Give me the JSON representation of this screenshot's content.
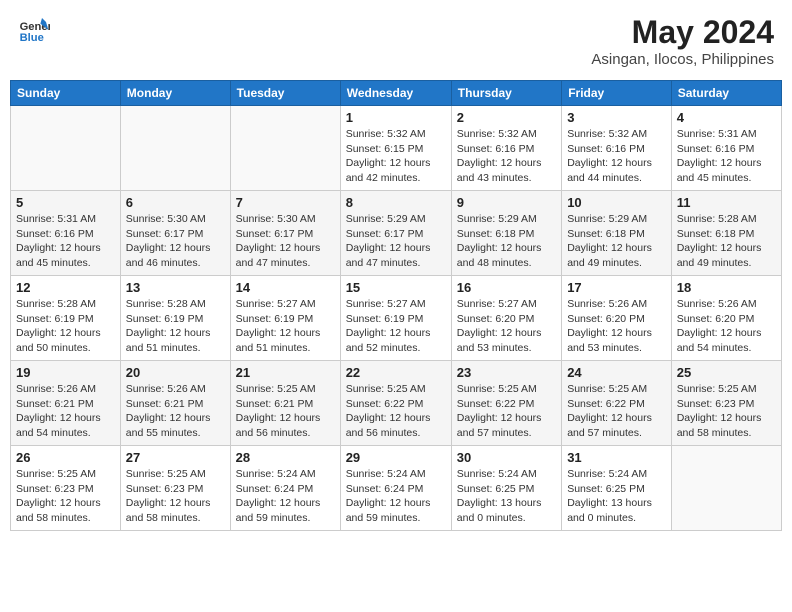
{
  "header": {
    "logo_line1": "General",
    "logo_line2": "Blue",
    "month_year": "May 2024",
    "location": "Asingan, Ilocos, Philippines"
  },
  "weekdays": [
    "Sunday",
    "Monday",
    "Tuesday",
    "Wednesday",
    "Thursday",
    "Friday",
    "Saturday"
  ],
  "weeks": [
    [
      {
        "day": "",
        "sunrise": "",
        "sunset": "",
        "daylight": ""
      },
      {
        "day": "",
        "sunrise": "",
        "sunset": "",
        "daylight": ""
      },
      {
        "day": "",
        "sunrise": "",
        "sunset": "",
        "daylight": ""
      },
      {
        "day": "1",
        "sunrise": "Sunrise: 5:32 AM",
        "sunset": "Sunset: 6:15 PM",
        "daylight": "Daylight: 12 hours and 42 minutes."
      },
      {
        "day": "2",
        "sunrise": "Sunrise: 5:32 AM",
        "sunset": "Sunset: 6:16 PM",
        "daylight": "Daylight: 12 hours and 43 minutes."
      },
      {
        "day": "3",
        "sunrise": "Sunrise: 5:32 AM",
        "sunset": "Sunset: 6:16 PM",
        "daylight": "Daylight: 12 hours and 44 minutes."
      },
      {
        "day": "4",
        "sunrise": "Sunrise: 5:31 AM",
        "sunset": "Sunset: 6:16 PM",
        "daylight": "Daylight: 12 hours and 45 minutes."
      }
    ],
    [
      {
        "day": "5",
        "sunrise": "Sunrise: 5:31 AM",
        "sunset": "Sunset: 6:16 PM",
        "daylight": "Daylight: 12 hours and 45 minutes."
      },
      {
        "day": "6",
        "sunrise": "Sunrise: 5:30 AM",
        "sunset": "Sunset: 6:17 PM",
        "daylight": "Daylight: 12 hours and 46 minutes."
      },
      {
        "day": "7",
        "sunrise": "Sunrise: 5:30 AM",
        "sunset": "Sunset: 6:17 PM",
        "daylight": "Daylight: 12 hours and 47 minutes."
      },
      {
        "day": "8",
        "sunrise": "Sunrise: 5:29 AM",
        "sunset": "Sunset: 6:17 PM",
        "daylight": "Daylight: 12 hours and 47 minutes."
      },
      {
        "day": "9",
        "sunrise": "Sunrise: 5:29 AM",
        "sunset": "Sunset: 6:18 PM",
        "daylight": "Daylight: 12 hours and 48 minutes."
      },
      {
        "day": "10",
        "sunrise": "Sunrise: 5:29 AM",
        "sunset": "Sunset: 6:18 PM",
        "daylight": "Daylight: 12 hours and 49 minutes."
      },
      {
        "day": "11",
        "sunrise": "Sunrise: 5:28 AM",
        "sunset": "Sunset: 6:18 PM",
        "daylight": "Daylight: 12 hours and 49 minutes."
      }
    ],
    [
      {
        "day": "12",
        "sunrise": "Sunrise: 5:28 AM",
        "sunset": "Sunset: 6:19 PM",
        "daylight": "Daylight: 12 hours and 50 minutes."
      },
      {
        "day": "13",
        "sunrise": "Sunrise: 5:28 AM",
        "sunset": "Sunset: 6:19 PM",
        "daylight": "Daylight: 12 hours and 51 minutes."
      },
      {
        "day": "14",
        "sunrise": "Sunrise: 5:27 AM",
        "sunset": "Sunset: 6:19 PM",
        "daylight": "Daylight: 12 hours and 51 minutes."
      },
      {
        "day": "15",
        "sunrise": "Sunrise: 5:27 AM",
        "sunset": "Sunset: 6:19 PM",
        "daylight": "Daylight: 12 hours and 52 minutes."
      },
      {
        "day": "16",
        "sunrise": "Sunrise: 5:27 AM",
        "sunset": "Sunset: 6:20 PM",
        "daylight": "Daylight: 12 hours and 53 minutes."
      },
      {
        "day": "17",
        "sunrise": "Sunrise: 5:26 AM",
        "sunset": "Sunset: 6:20 PM",
        "daylight": "Daylight: 12 hours and 53 minutes."
      },
      {
        "day": "18",
        "sunrise": "Sunrise: 5:26 AM",
        "sunset": "Sunset: 6:20 PM",
        "daylight": "Daylight: 12 hours and 54 minutes."
      }
    ],
    [
      {
        "day": "19",
        "sunrise": "Sunrise: 5:26 AM",
        "sunset": "Sunset: 6:21 PM",
        "daylight": "Daylight: 12 hours and 54 minutes."
      },
      {
        "day": "20",
        "sunrise": "Sunrise: 5:26 AM",
        "sunset": "Sunset: 6:21 PM",
        "daylight": "Daylight: 12 hours and 55 minutes."
      },
      {
        "day": "21",
        "sunrise": "Sunrise: 5:25 AM",
        "sunset": "Sunset: 6:21 PM",
        "daylight": "Daylight: 12 hours and 56 minutes."
      },
      {
        "day": "22",
        "sunrise": "Sunrise: 5:25 AM",
        "sunset": "Sunset: 6:22 PM",
        "daylight": "Daylight: 12 hours and 56 minutes."
      },
      {
        "day": "23",
        "sunrise": "Sunrise: 5:25 AM",
        "sunset": "Sunset: 6:22 PM",
        "daylight": "Daylight: 12 hours and 57 minutes."
      },
      {
        "day": "24",
        "sunrise": "Sunrise: 5:25 AM",
        "sunset": "Sunset: 6:22 PM",
        "daylight": "Daylight: 12 hours and 57 minutes."
      },
      {
        "day": "25",
        "sunrise": "Sunrise: 5:25 AM",
        "sunset": "Sunset: 6:23 PM",
        "daylight": "Daylight: 12 hours and 58 minutes."
      }
    ],
    [
      {
        "day": "26",
        "sunrise": "Sunrise: 5:25 AM",
        "sunset": "Sunset: 6:23 PM",
        "daylight": "Daylight: 12 hours and 58 minutes."
      },
      {
        "day": "27",
        "sunrise": "Sunrise: 5:25 AM",
        "sunset": "Sunset: 6:23 PM",
        "daylight": "Daylight: 12 hours and 58 minutes."
      },
      {
        "day": "28",
        "sunrise": "Sunrise: 5:24 AM",
        "sunset": "Sunset: 6:24 PM",
        "daylight": "Daylight: 12 hours and 59 minutes."
      },
      {
        "day": "29",
        "sunrise": "Sunrise: 5:24 AM",
        "sunset": "Sunset: 6:24 PM",
        "daylight": "Daylight: 12 hours and 59 minutes."
      },
      {
        "day": "30",
        "sunrise": "Sunrise: 5:24 AM",
        "sunset": "Sunset: 6:25 PM",
        "daylight": "Daylight: 13 hours and 0 minutes."
      },
      {
        "day": "31",
        "sunrise": "Sunrise: 5:24 AM",
        "sunset": "Sunset: 6:25 PM",
        "daylight": "Daylight: 13 hours and 0 minutes."
      },
      {
        "day": "",
        "sunrise": "",
        "sunset": "",
        "daylight": ""
      }
    ]
  ]
}
